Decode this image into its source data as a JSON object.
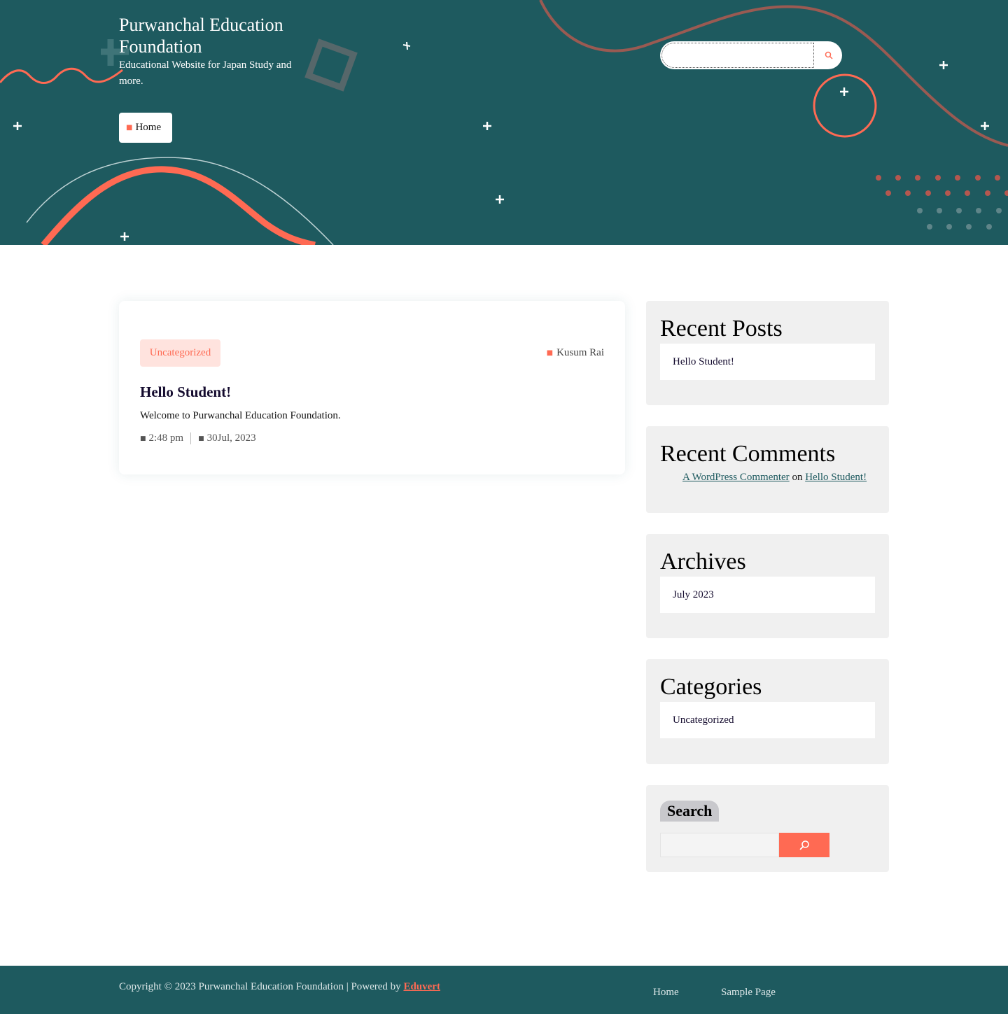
{
  "colors": {
    "brand": "#1e5a5f",
    "accent": "#ff6a53",
    "widget_bg": "#f0f0f0"
  },
  "header": {
    "site_title": "Purwanchal Education Foundation",
    "tagline": "Educational Website for Japan Study and more.",
    "nav": {
      "home_label": "Home",
      "home_icon": "home-icon"
    },
    "search": {
      "value": "",
      "button_icon": "search-icon"
    }
  },
  "post": {
    "category": "Uncategorized",
    "author": "Kusum Rai",
    "title": "Hello Student!",
    "excerpt": "Welcome to Purwanchal Education Foundation.",
    "time": "2:48 pm",
    "date": "30Jul, 2023"
  },
  "sidebar": {
    "recent_posts": {
      "title": "Recent Posts",
      "items": [
        "Hello Student!"
      ]
    },
    "recent_comments": {
      "title": "Recent Comments",
      "author": "A WordPress Commenter",
      "on": "on",
      "post": "Hello Student!"
    },
    "archives": {
      "title": "Archives",
      "items": [
        "July 2023"
      ]
    },
    "categories": {
      "title": "Categories",
      "items": [
        "Uncategorized"
      ]
    },
    "search": {
      "label": "Search",
      "value": "",
      "button_icon": "search-icon"
    }
  },
  "footer": {
    "copyright": "Copyright © 2023 Purwanchal Education Foundation | Powered by",
    "powered_by": "Eduvert",
    "nav": [
      "Home",
      "Sample Page"
    ]
  }
}
